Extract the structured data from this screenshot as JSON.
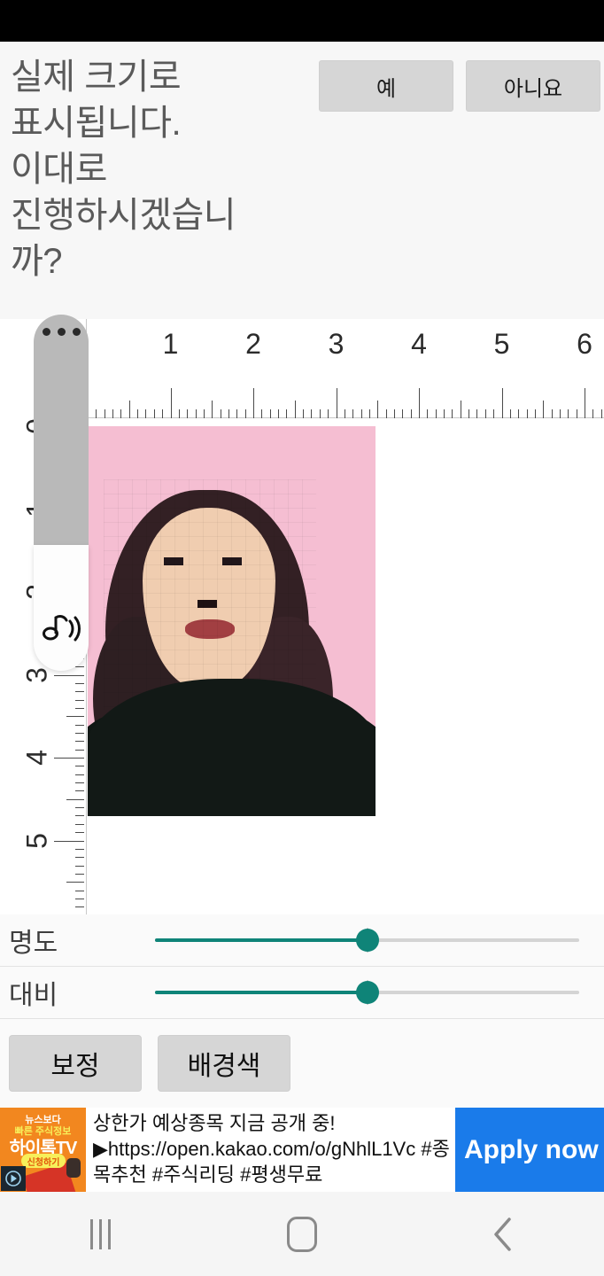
{
  "dialog": {
    "message": "실제 크기로\n표시됩니다.\n이대로\n진행하시겠습니\n까?",
    "yes_label": "예",
    "no_label": "아니요"
  },
  "ruler": {
    "horizontal_numbers": [
      "1",
      "2",
      "3",
      "4",
      "5",
      "6"
    ],
    "vertical_numbers": [
      "0",
      "1",
      "2",
      "3",
      "4",
      "5"
    ],
    "unit_hint": "cm"
  },
  "photo": {
    "background_color": "#f5bed2",
    "description": "id-photo-pixelated-face"
  },
  "float_widget": {
    "dots_icon": "more-dots-icon",
    "sound_icon": "music-note-sound-icon"
  },
  "sliders": [
    {
      "label": "명도",
      "value": 50,
      "fill_color": "#0f8478"
    },
    {
      "label": "대비",
      "value": 50,
      "fill_color": "#0f8478"
    }
  ],
  "actions": {
    "correct_label": "보정",
    "background_color_label": "배경색"
  },
  "ad": {
    "logo_line1": "뉴스보다",
    "logo_line2": "빠른 주식정보",
    "logo_line3": "하이톡TV",
    "logo_badge": "신청하기",
    "headline": "상한가 예상종목 지금 공개 중!",
    "line2": "▶https://open.kakao.com/o/gNhlL1Vc #종",
    "line3": "목추천 #주식리딩 #평생무료",
    "cta_label": "Apply now",
    "cta_color": "#1a7bea",
    "adchoices_icon": "adchoices-triangle-icon"
  },
  "navbar": {
    "recents_icon": "recents-icon",
    "home_icon": "home-icon",
    "back_icon": "back-chevron-icon"
  }
}
